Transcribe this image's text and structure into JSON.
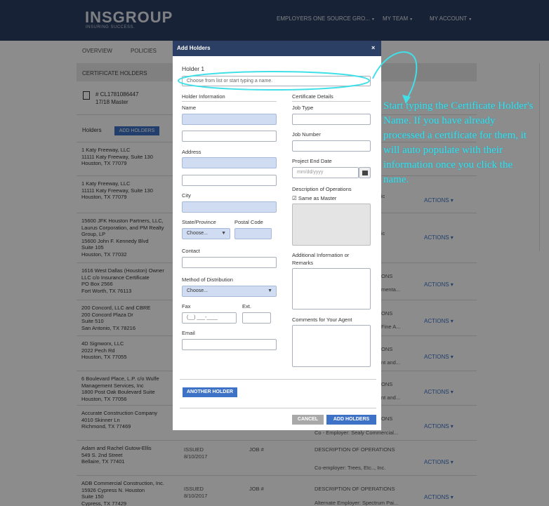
{
  "header": {
    "logo": "INSGROUP",
    "tagline": "INSURING SUCCESS.",
    "nav": [
      {
        "label": "EMPLOYERS ONE SOURCE GRO...",
        "caret": "▾"
      },
      {
        "label": "MY TEAM",
        "caret": "▾"
      },
      {
        "label": "MY ACCOUNT",
        "caret": "▾"
      }
    ]
  },
  "tabs": [
    "OVERVIEW",
    "POLICIES"
  ],
  "certificate": {
    "section_title": "CERTIFICATE HOLDERS",
    "number": "# CL1781086447",
    "sub": "17/18 Master"
  },
  "holders": {
    "label": "Holders",
    "add_button": "ADD HOLDERS",
    "rows": [
      {
        "address": "1 Katy Freeway, LLC\n11111 Katy Freeway, Suite 130\nHouston, TX 77079",
        "status": "",
        "job": "",
        "doh": "",
        "dov": "",
        "actions": ""
      },
      {
        "address": "1 Katy Freeway, LLC\n11111 Katy Freeway, Suite 130\nHouston, TX 77079",
        "status": "",
        "job": "",
        "doh": "",
        "dov": "ctic",
        "actions": "ACTIONS ▾"
      },
      {
        "address": "15600 JFK Houston Partners, LLC,\nLaurus Corporation, and PM Realty\nGroup, LP\n15600 John F. Kennedy Blvd\nSuite 105\nHouston, TX 77032",
        "status": "",
        "job": "",
        "doh": "",
        "dov": "ctic",
        "actions": "ACTIONS ▾"
      },
      {
        "address": "1616 West Dallas (Houston) Owner\nLLC c/o Insurance Certificate\nPO Box 2566\nFort Worth, TX 76113",
        "status": "",
        "job": "",
        "doh": "ONS",
        "dov": "menta...",
        "actions": "ACTIONS ▾"
      },
      {
        "address": "200 Concord, LLC and CBRE\n200 Concord Plaza Dr\nSuite 510\nSan Antonio, TX 78216",
        "status": "",
        "job": "",
        "doh": "ONS",
        "dov": "Fine A...",
        "actions": "ACTIONS ▾"
      },
      {
        "address": "4D Signworx, LLC\n2022 Pech Rd\nHouston, TX 77055",
        "status": "",
        "job": "",
        "doh": "ONS",
        "dov": "nt and...",
        "actions": "ACTIONS ▾"
      },
      {
        "address": "6 Boulevard Place, L.P. c/o Wulfe\nManagement Services, Inc\n1800 Post Oak Boulevard Suite\nHouston, TX 77056",
        "status": "",
        "job": "",
        "doh": "ONS",
        "dov": "nt and...",
        "actions": "ACTIONS ▾"
      },
      {
        "address": "Accurate Construction Company\n4010 Skinner Ln\nRichmond, TX 77469",
        "status": "",
        "job": "",
        "doh": "ONS",
        "dov": "Co - Employer: Sealy Commercial...",
        "actions": "ACTIONS ▾"
      },
      {
        "address": "Adam and Rachel Gutow-Ellis\n549 S. 2nd Street\nBellaire, TX 77401",
        "status": "ISSUED\n8/10/2017",
        "job": "JOB #",
        "doh": "DESCRIPTION OF OPERATIONS",
        "dov": "Co-employer: Trees, Etc.., Inc.",
        "actions": "ACTIONS ▾"
      },
      {
        "address": "ADB Commercial Construction, Inc.\n15926 Cypress N. Houston\nSuite 150\nCypress, TX 77429",
        "status": "ISSUED\n8/10/2017",
        "job": "JOB #",
        "doh": "DESCRIPTION OF OPERATIONS",
        "dov": "Alternate Employer: Spectrum Pai...",
        "actions": "ACTIONS ▾"
      }
    ]
  },
  "modal": {
    "title": "Add Holders",
    "close": "×",
    "holder_label": "Holder 1",
    "holder_placeholder": "Choose from list or start typing a name.",
    "left_heading": "Holder Information",
    "right_heading": "Certificate Details",
    "name": "Name",
    "address": "Address",
    "city": "City",
    "state": "State/Province",
    "state_value": "Choose...",
    "postal": "Postal Code",
    "contact": "Contact",
    "method": "Method of Distribution",
    "method_value": "Choose...",
    "fax": "Fax",
    "fax_placeholder": "(__) ___-____",
    "ext": "Ext.",
    "email": "Email",
    "job_type": "Job Type",
    "job_number": "Job Number",
    "project_end": "Project End Date",
    "date_placeholder": "mm/dd/yyyy",
    "desc_ops": "Description of Operations",
    "same_as_master": "Same as Master",
    "additional": "Additional Information or",
    "remarks": "Remarks",
    "comments": "Comments for Your Agent",
    "another_holder": "ANOTHER HOLDER",
    "cancel": "CANCEL",
    "add_holders": "ADD HOLDERS"
  },
  "annotation": {
    "text": "Start typing the Certificate Holder's Name.  If you have already processed a certificate for them, it will auto populate with their information once you click the name."
  },
  "colors": {
    "header_bg": "#2b3e63",
    "accent_blue": "#3e72c7",
    "annotation": "#3fe0e8"
  }
}
